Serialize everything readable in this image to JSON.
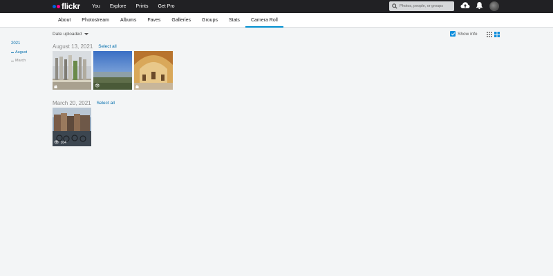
{
  "topbar": {
    "logo_text": "flickr",
    "nav": [
      "You",
      "Explore",
      "Prints",
      "Get Pro"
    ],
    "search_placeholder": "Photos, people, or groups"
  },
  "subnav": {
    "items": [
      "About",
      "Photostream",
      "Albums",
      "Faves",
      "Galleries",
      "Groups",
      "Stats",
      "Camera Roll"
    ],
    "active": "Camera Roll"
  },
  "timeline": {
    "year": "2021",
    "months": [
      "August",
      "March"
    ],
    "active_month": "August"
  },
  "toolbar": {
    "sort_label": "Date uploaded",
    "show_info_label": "Show info",
    "show_info_checked": true
  },
  "sections": [
    {
      "date": "August 13, 2021",
      "select_all": "Select all",
      "photos": [
        {
          "subject": "stone ruins",
          "badge": "lock-icon"
        },
        {
          "subject": "blue sky landscape",
          "badge": "eye-icon"
        },
        {
          "subject": "ornate dome interior",
          "badge": "lock-icon"
        }
      ]
    },
    {
      "date": "March 20, 2021",
      "select_all": "Select all",
      "photos": [
        {
          "subject": "canal with bicycles",
          "badge": "eye-icon",
          "views": "104"
        }
      ]
    }
  ],
  "colors": {
    "topbar": "#212124",
    "accent": "#008ecf",
    "link": "#006dac",
    "background": "#f3f5f6"
  }
}
